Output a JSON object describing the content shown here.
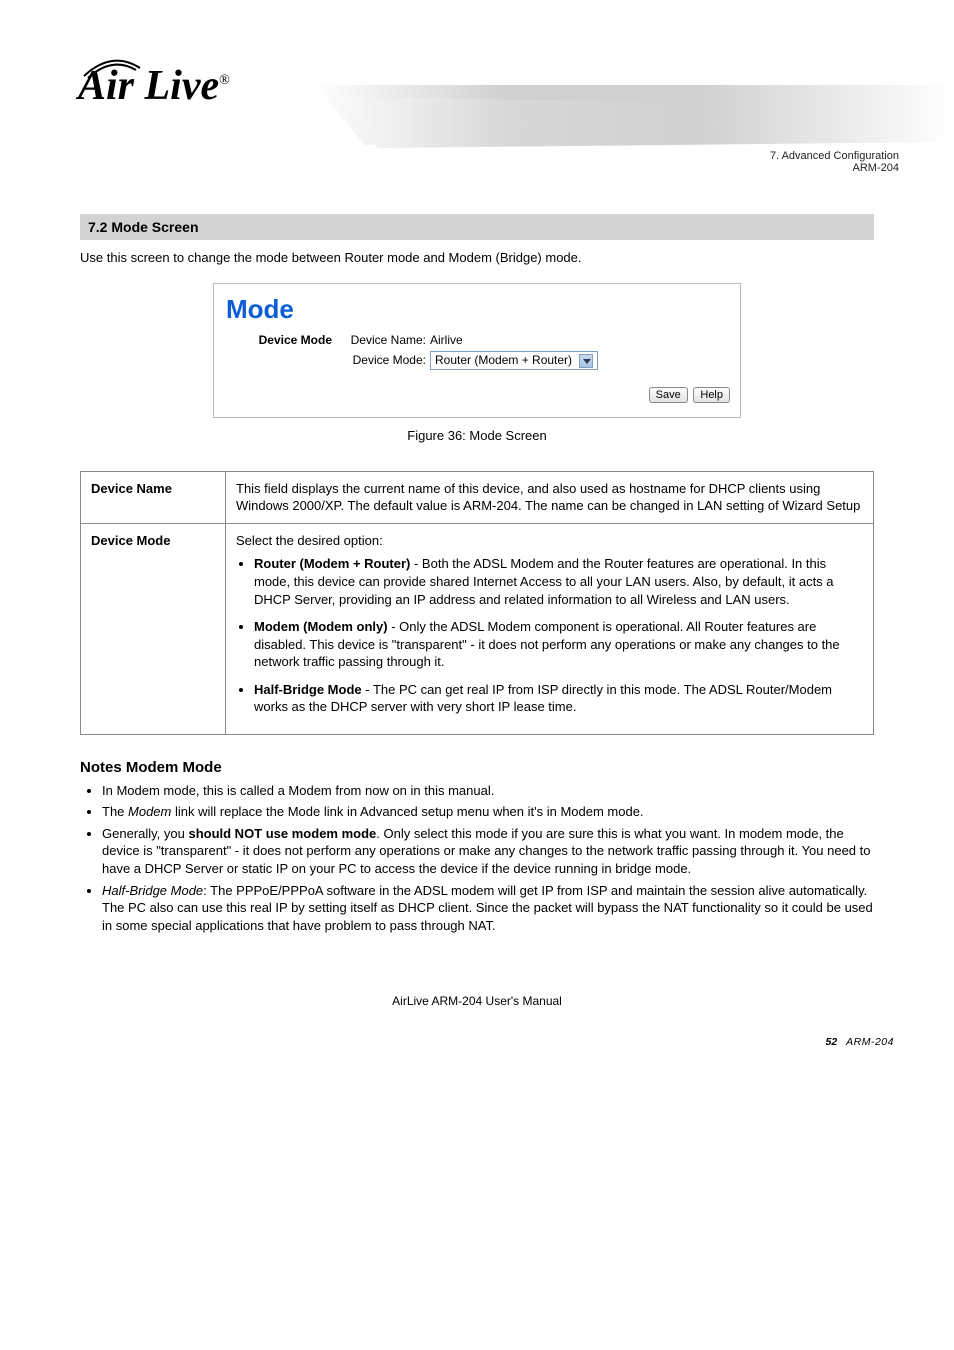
{
  "header": {
    "logo_text": "Air Live",
    "logo_reg": "®",
    "chapter_line1": "7. Advanced Configuration",
    "chapter_line2": "ARM-204"
  },
  "section": {
    "bar_title": "7.2 Mode Screen",
    "intro_text": "Use this screen to change the mode between Router mode and Modem (Bridge) mode."
  },
  "mode_panel": {
    "panel_title": "Mode",
    "group_label": "Device Mode",
    "name_label": "Device Name:",
    "name_value": "Airlive",
    "mode_label": "Device Mode:",
    "mode_value": "Router (Modem + Router)",
    "save_btn": "Save",
    "help_btn": "Help"
  },
  "figure": {
    "caption": "Figure 36: Mode Screen"
  },
  "table": {
    "r1_label": "Device Name",
    "r1_text": "This field displays the current name of this device, and also used as hostname for DHCP clients using Windows 2000/XP. The default value is ARM-204. The name can be changed in LAN setting of Wizard Setup",
    "r2_label": "Device Mode",
    "r2_intro": "Select the desired option:",
    "r2_b1_title": "Router (Modem + Router)",
    "r2_b1_text": " -   Both the ADSL Modem and the Router features are operational. In this mode, this device can provide shared Internet Access to all your LAN users. Also, by default, it acts a DHCP Server, providing an IP address and related information to all Wireless and LAN users.",
    "r2_b2_title": "Modem (Modem only)",
    "r2_b2_text": " -   Only the ADSL Modem component is operational. All Router features are disabled. This device is \"transparent\" - it does not perform any operations or make any changes to the network traffic passing through it.",
    "r2_b3_title": "Half-Bridge Mode",
    "r2_b3_text": " -   The PC can get real IP from ISP directly in this mode. The ADSL Router/Modem works as the DHCP server with very short IP lease time."
  },
  "notes": {
    "title": "Notes Modem Mode",
    "n1": "In Modem mode, this is called a Modem from now on in this manual.",
    "n2_a": "The ",
    "n2_em": "Modem",
    "n2_b": " link will replace the Mode link in Advanced setup menu when it's in Modem mode.",
    "n3_a": "Generally, you ",
    "n3_b1": "should NOT use modem mode",
    "n3_c": ". Only select this mode if you are sure this is what you want. In modem mode, the device is \"transparent\" - it does not perform any operations or make any changes to the network traffic passing through it. You need to have a DHCP Server or static IP on your PC to access the device if the device running in bridge mode.",
    "n4_a": "",
    "n4_em": "Half-Bridge Mode",
    "n4_b": ": The PPPoE/PPPoA software in the ADSL modem will get IP from ISP and maintain the session alive automatically. The PC also can use this real IP by setting itself as DHCP client. Since the packet will bypass the NAT functionality so it could be used in some special applications that have problem to pass through NAT."
  },
  "footer": {
    "text": "AirLive ARM-204 User's Manual",
    "pageno": "52",
    "model": "ARM-204"
  }
}
